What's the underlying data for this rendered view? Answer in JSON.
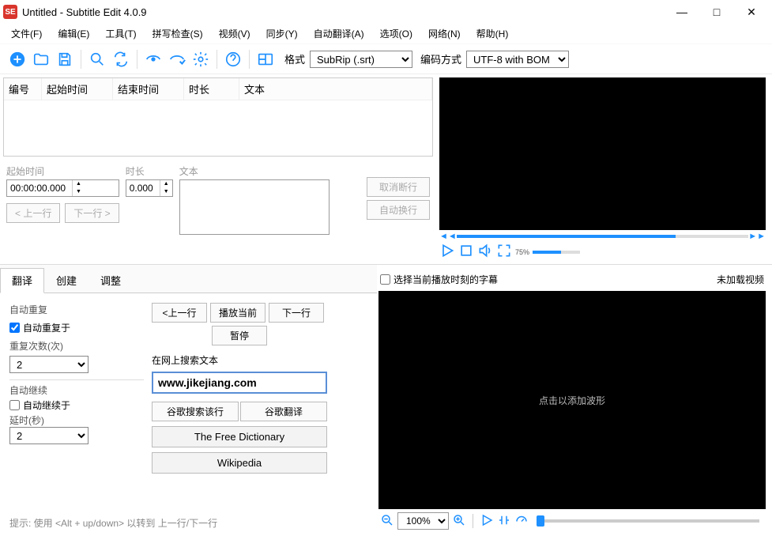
{
  "titlebar": {
    "app_icon": "SE",
    "title": "Untitled - Subtitle Edit 4.0.9"
  },
  "menus": {
    "file": "文件(F)",
    "edit": "编辑(E)",
    "tools": "工具(T)",
    "spell": "拼写检查(S)",
    "video": "视频(V)",
    "sync": "同步(Y)",
    "autotrans": "自动翻译(A)",
    "options": "选项(O)",
    "network": "网络(N)",
    "help": "帮助(H)"
  },
  "toolbar": {
    "format_label": "格式",
    "format_value": "SubRip (.srt)",
    "encoding_label": "编码方式",
    "encoding_value": "UTF-8 with BOM"
  },
  "grid": {
    "col_num": "编号",
    "col_start": "起始时间",
    "col_end": "结束时间",
    "col_dur": "时长",
    "col_text": "文本"
  },
  "edit": {
    "start_label": "起始时间",
    "start_value": "00:00:00.000",
    "dur_label": "时长",
    "dur_value": "0.000",
    "text_label": "文本",
    "unbreak": "取消断行",
    "autobreak": "自动换行",
    "prev": "< 上一行",
    "next": "下一行 >"
  },
  "player": {
    "pos_pct": 75,
    "pos_label": "75%"
  },
  "tabs": {
    "translate": "翻译",
    "create": "创建",
    "adjust": "调整"
  },
  "autorepeat": {
    "group": "自动重复",
    "on": "自动重复于",
    "count_label": "重复次数(次)",
    "count": "2"
  },
  "autocontinue": {
    "group": "自动继续",
    "on": "自动继续于",
    "delay_label": "延时(秒)",
    "delay": "2"
  },
  "nav": {
    "prev": "<上一行",
    "playcur": "播放当前",
    "next": "下一行",
    "pause": "暂停"
  },
  "search": {
    "label": "在网上搜索文本",
    "value": "www.jikejiang.com",
    "google": "谷歌搜索该行",
    "gtrans": "谷歌翻译",
    "tfd": "The Free Dictionary",
    "wiki": "Wikipedia"
  },
  "hint": "提示: 使用 <Alt + up/down> 以转到 上一行/下一行",
  "wave": {
    "select_at_play": "选择当前播放时刻的字幕",
    "novideo": "未加载视频",
    "placeholder": "点击以添加波形",
    "zoom": "100%"
  }
}
